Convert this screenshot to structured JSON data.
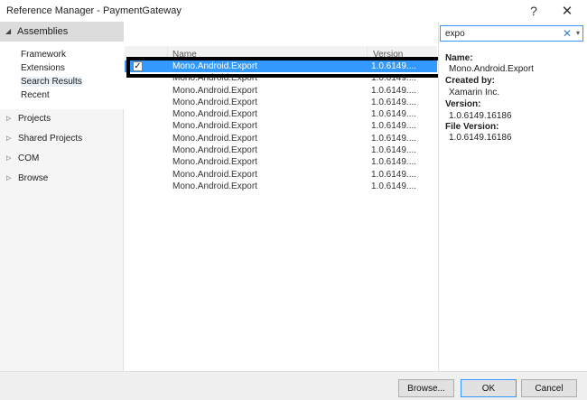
{
  "window": {
    "title": "Reference Manager - PaymentGateway",
    "help": "?",
    "close": "✕"
  },
  "nav": {
    "assemblies": "Assemblies",
    "sub": [
      "Framework",
      "Extensions",
      "Search Results",
      "Recent"
    ],
    "items": [
      "Projects",
      "Shared Projects",
      "COM",
      "Browse"
    ]
  },
  "list": {
    "header_name": "Name",
    "header_version": "Version",
    "rows": [
      {
        "name": "Mono.Android.Export",
        "version": "1.0.6149....",
        "checked": true
      },
      {
        "name": "Mono.Android.Export",
        "version": "1.0.6149...."
      },
      {
        "name": "Mono.Android.Export",
        "version": "1.0.6149...."
      },
      {
        "name": "Mono.Android.Export",
        "version": "1.0.6149...."
      },
      {
        "name": "Mono.Android.Export",
        "version": "1.0.6149...."
      },
      {
        "name": "Mono.Android.Export",
        "version": "1.0.6149...."
      },
      {
        "name": "Mono.Android.Export",
        "version": "1.0.6149...."
      },
      {
        "name": "Mono.Android.Export",
        "version": "1.0.6149...."
      },
      {
        "name": "Mono.Android.Export",
        "version": "1.0.6149...."
      },
      {
        "name": "Mono.Android.Export",
        "version": "1.0.6149...."
      },
      {
        "name": "Mono.Android.Export",
        "version": "1.0.6149...."
      }
    ]
  },
  "search": {
    "value": "expo",
    "clear": "✕",
    "dropdown": "▾"
  },
  "details": {
    "name_label": "Name:",
    "name_value": "Mono.Android.Export",
    "created_label": "Created by:",
    "created_value": "Xamarin Inc.",
    "version_label": "Version:",
    "version_value": "1.0.6149.16186",
    "file_version_label": "File Version:",
    "file_version_value": "1.0.6149.16186"
  },
  "buttons": {
    "browse": "Browse...",
    "ok": "OK",
    "cancel": "Cancel"
  }
}
